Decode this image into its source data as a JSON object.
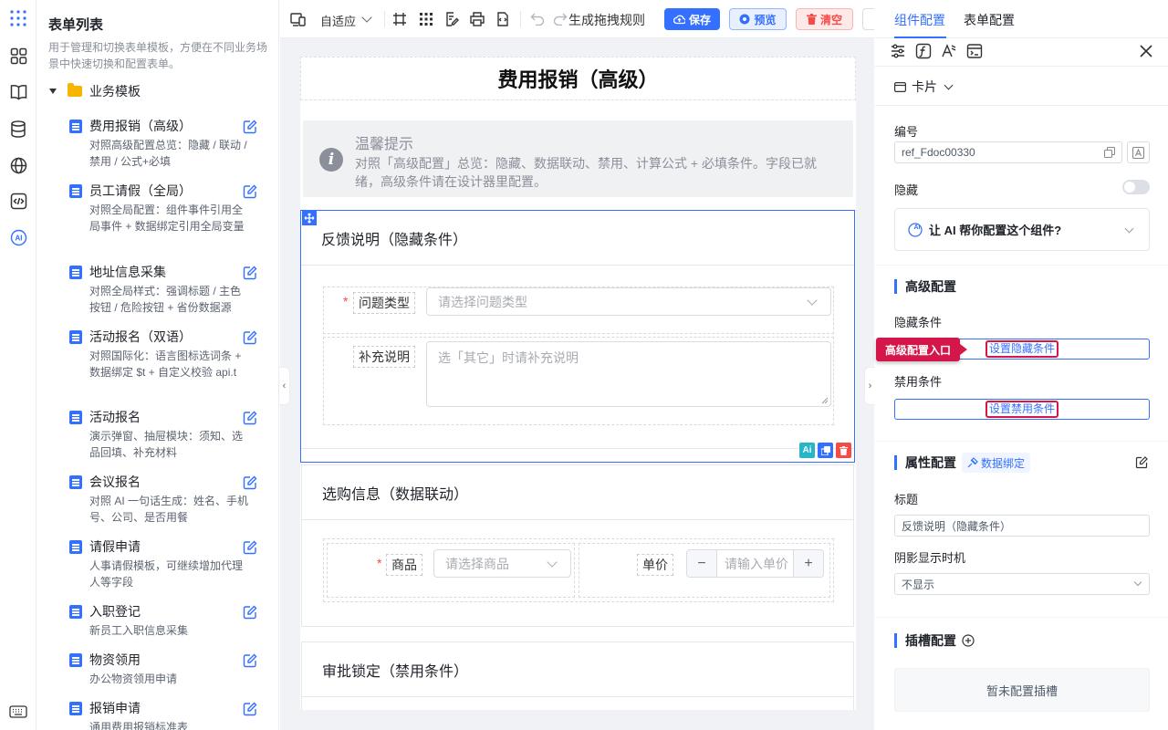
{
  "sidebar_list": {
    "title": "表单列表",
    "description": "用于管理和切换表单模板，方便在不同业务场景中快速切换和配置表单。",
    "group": "业务模板",
    "templates": [
      {
        "name": "费用报销（高级）",
        "desc": "对照高级配置总览：隐藏 / 联动 / 禁用 / 公式+必填"
      },
      {
        "name": "员工请假（全局）",
        "desc": "对照全局配置：组件事件引用全局事件 + 数据绑定引用全局变量"
      },
      {
        "name": "地址信息采集",
        "desc": "对照全局样式：强调标题 / 主色按钮 / 危险按钮 + 省份数据源"
      },
      {
        "name": "活动报名（双语）",
        "desc": "对照国际化：语言图标选词条 + 数据绑定 $t + 自定义校验 api.t"
      },
      {
        "name": "活动报名",
        "desc": "演示弹窗、抽屉模块：须知、选品回填、补充材料"
      },
      {
        "name": "会议报名",
        "desc": "对照 AI 一句话生成：姓名、手机号、公司、是否用餐"
      },
      {
        "name": "请假申请",
        "desc": "人事请假模板，可继续增加代理人等字段"
      },
      {
        "name": "入职登记",
        "desc": "新员工入职信息采集"
      },
      {
        "name": "物资领用",
        "desc": "办公物资领用申请"
      },
      {
        "name": "报销申请",
        "desc": "通用费用报销标准表"
      }
    ]
  },
  "toolbar": {
    "adapt_label": "自适应",
    "gen_rules_label": "生成拖拽规则",
    "save_label": "保存",
    "preview_label": "预览",
    "clear_label": "清空"
  },
  "canvas": {
    "form_title": "费用报销（高级）",
    "tip_title": "温馨提示",
    "tip_content": "对照「高级配置」总览：隐藏、数据联动、禁用、计算公式 + 必填条件。字段已就绪，高级条件请在设计器里配置。",
    "card1": {
      "title": "反馈说明（隐藏条件）",
      "req_mark": "*",
      "field1_label": "问题类型",
      "field1_placeholder": "请选择问题类型",
      "field2_label": "补充说明",
      "field2_placeholder": "选「其它」时请补充说明",
      "ai_badge": "Ai"
    },
    "card2": {
      "title": "选购信息（数据联动）",
      "req_mark": "*",
      "product_label": "商品",
      "product_placeholder": "请选择商品",
      "price_label": "单价",
      "price_placeholder": "请输入单价",
      "minus": "−",
      "plus": "+"
    },
    "card3": {
      "title": "审批锁定（禁用条件）"
    }
  },
  "right_panel": {
    "tab_component": "组件配置",
    "tab_form": "表单配置",
    "card_type": "卡片",
    "id_label": "编号",
    "id_value": "ref_Fdoc00330",
    "hidden_label": "隐藏",
    "ai_help": "让 AI 帮你配置这个组件?",
    "ai_badge": "AI",
    "advanced_title": "高级配置",
    "hide_cond_label": "隐藏条件",
    "hide_cond_btn": "设置隐藏条件",
    "disable_cond_label": "禁用条件",
    "disable_cond_btn": "设置禁用条件",
    "callout": "高级配置入口",
    "attr_title": "属性配置",
    "data_binding": "数据绑定",
    "title_label": "标题",
    "title_value": "反馈说明（隐藏条件）",
    "shadow_label": "阴影显示时机",
    "shadow_value": "不显示",
    "slot_title": "插槽配置",
    "slot_empty": "暂未配置插槽"
  },
  "colors": {
    "primary": "#3370ff",
    "danger": "#f54a45",
    "callout": "#d4164a"
  }
}
